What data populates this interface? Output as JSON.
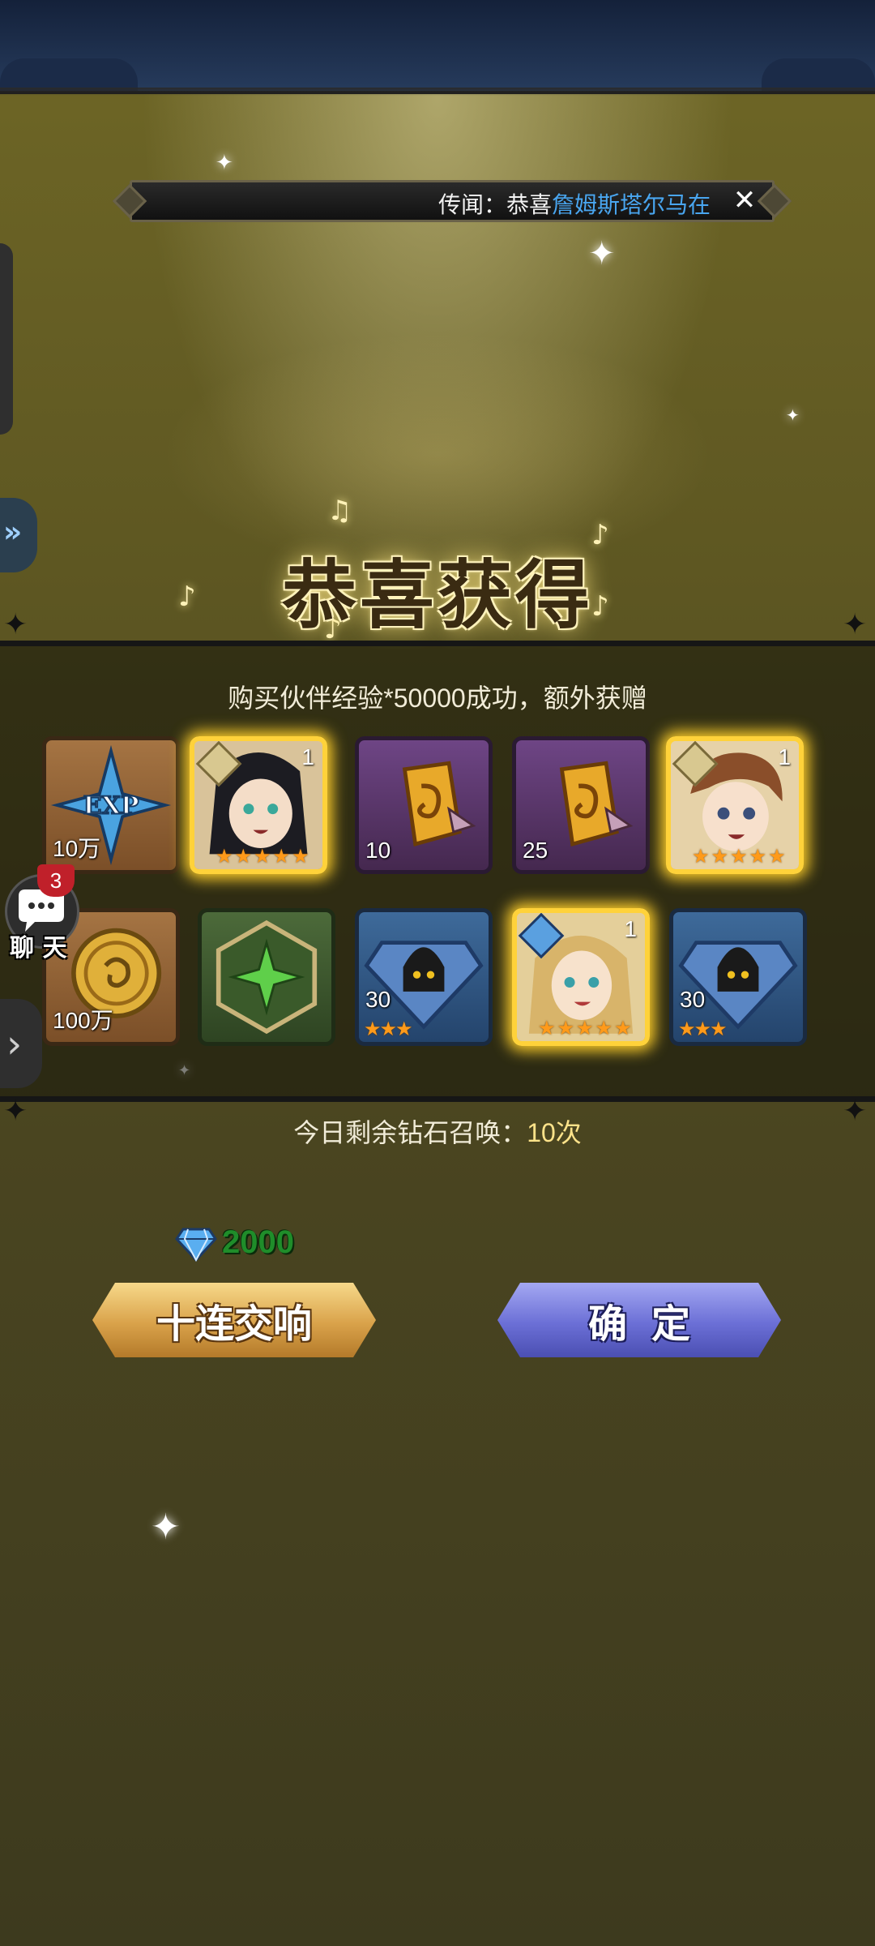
{
  "ticker": {
    "prefix": "传闻：恭喜",
    "highlight": "詹姆斯塔尔马在",
    "close_icon": "close-icon"
  },
  "title": "恭喜获得",
  "reward_message": "购买伙伴经验*50000成功，额外获赠",
  "items": [
    {
      "type": "exp",
      "qty": "10万",
      "icon": "exp-star-icon"
    },
    {
      "type": "hero",
      "level": "1",
      "stars": "★★★★★",
      "icon": "hero-portrait-icon"
    },
    {
      "type": "scroll",
      "qty": "10",
      "icon": "gold-rune-icon"
    },
    {
      "type": "scroll",
      "qty": "25",
      "icon": "gold-rune-icon"
    },
    {
      "type": "hero",
      "level": "1",
      "stars": "★★★★★",
      "icon": "hero-portrait-icon"
    },
    {
      "type": "gold",
      "qty": "100万",
      "icon": "gold-coin-icon"
    },
    {
      "type": "emblem",
      "qty": "",
      "icon": "green-emblem-icon"
    },
    {
      "type": "shard",
      "qty": "30",
      "stars": "★★★",
      "icon": "hero-shard-icon"
    },
    {
      "type": "hero",
      "level": "1",
      "stars": "★★★★★",
      "icon": "hero-portrait-icon"
    },
    {
      "type": "shard",
      "qty": "30",
      "stars": "★★★",
      "icon": "hero-shard-icon"
    }
  ],
  "chat": {
    "label": "聊 天",
    "badge": "3"
  },
  "summons": {
    "label": "今日剩余钻石召唤：",
    "count": "10次"
  },
  "diamonds": "2000",
  "buttons": {
    "ten_pull": "十连交响",
    "confirm": "确定"
  },
  "colors": {
    "accent_gold": "#d9a24a",
    "accent_blue": "#6b6fd6",
    "highlight_blue": "#49a6f0",
    "diamond_green": "#1f8d2a"
  }
}
